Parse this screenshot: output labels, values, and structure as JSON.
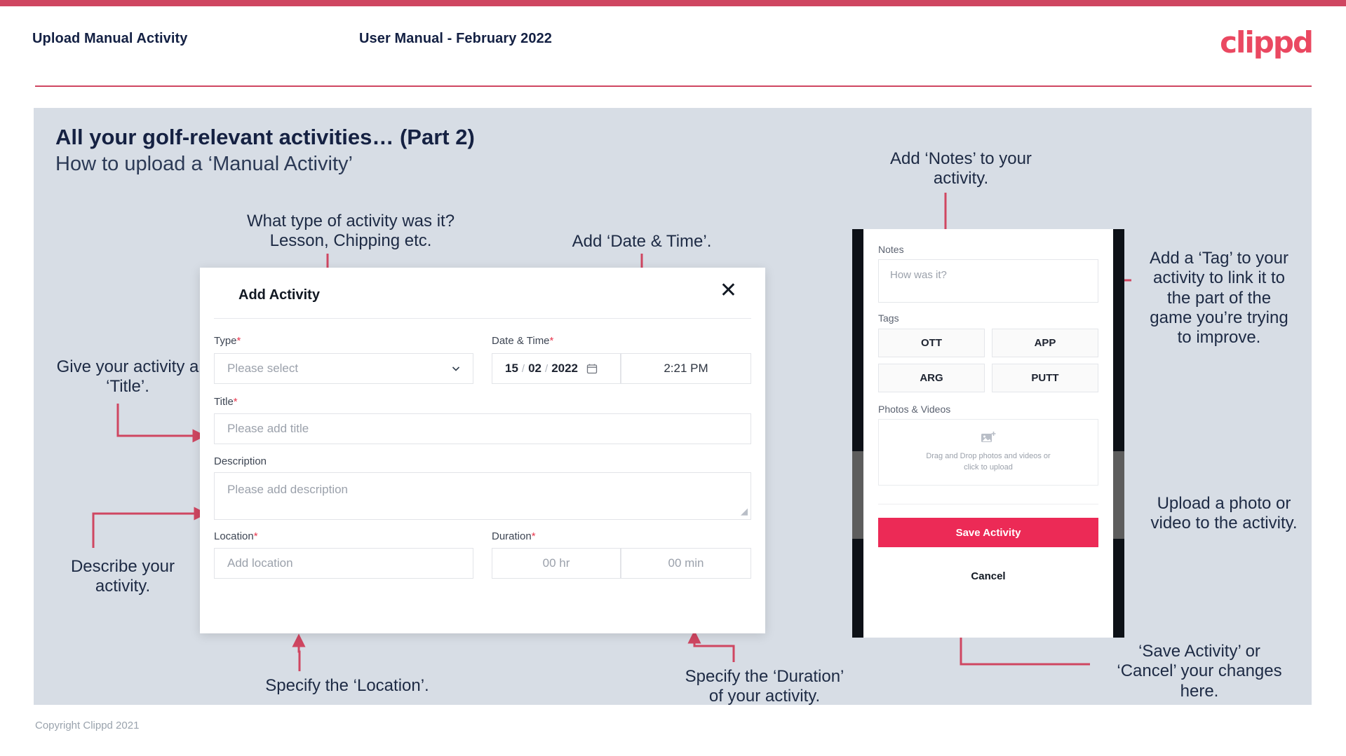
{
  "header": {
    "title": "Upload Manual Activity",
    "subtitle": "User Manual - February 2022",
    "logo": "clippd"
  },
  "slide": {
    "title": "All your golf-relevant activities… (Part 2)",
    "subtitle": "How to upload a ‘Manual Activity’",
    "footer": "Copyright Clippd 2021"
  },
  "dialog": {
    "title": "Add Activity",
    "close_icon": "close-icon",
    "fields": {
      "type": {
        "label": "Type",
        "required": "*",
        "placeholder": "Please select",
        "chevron_icon": "chevron-down-icon"
      },
      "datetime": {
        "label": "Date & Time",
        "required": "*",
        "day": "15",
        "sep1": "/",
        "month": "02",
        "sep2": "/",
        "year": "2022",
        "calendar_icon": "calendar-icon",
        "time": "2:21 PM"
      },
      "title": {
        "label": "Title",
        "required": "*",
        "placeholder": "Please add title"
      },
      "description": {
        "label": "Description",
        "required": "",
        "placeholder": "Please add description"
      },
      "location": {
        "label": "Location",
        "required": "*",
        "placeholder": "Add location"
      },
      "duration": {
        "label": "Duration",
        "required": "*",
        "hours": "00 hr",
        "minutes": "00 min"
      }
    }
  },
  "phone": {
    "notes": {
      "label": "Notes",
      "placeholder": "How was it?"
    },
    "tags": {
      "label": "Tags",
      "items": [
        "OTT",
        "APP",
        "ARG",
        "PUTT"
      ]
    },
    "photos": {
      "label": "Photos & Videos",
      "icon": "add-image-icon",
      "drop_line1": "Drag and Drop photos and videos or",
      "drop_line2": "click to upload"
    },
    "save_label": "Save Activity",
    "cancel_label": "Cancel"
  },
  "annotations": {
    "type": "What type of activity was it?\nLesson, Chipping etc.",
    "datetime": "Add ‘Date & Time’.",
    "title": "Give your activity a\n‘Title’.",
    "description": "Describe your\nactivity.",
    "location": "Specify the ‘Location’.",
    "duration": "Specify the ‘Duration’\nof your activity.",
    "notes": "Add ‘Notes’ to your\nactivity.",
    "tags": "Add a ‘Tag’ to your\nactivity to link it to\nthe part of the\ngame you’re trying\nto improve.",
    "photos": "Upload a photo or\nvideo to the activity.",
    "save": "‘Save Activity’ or\n‘Cancel’ your changes\nhere."
  },
  "colors": {
    "accent": "#cf4661",
    "brand": "#ea4861",
    "save": "#ec2a56",
    "slide_bg": "#d7dde5",
    "text": "#1d2a44"
  }
}
